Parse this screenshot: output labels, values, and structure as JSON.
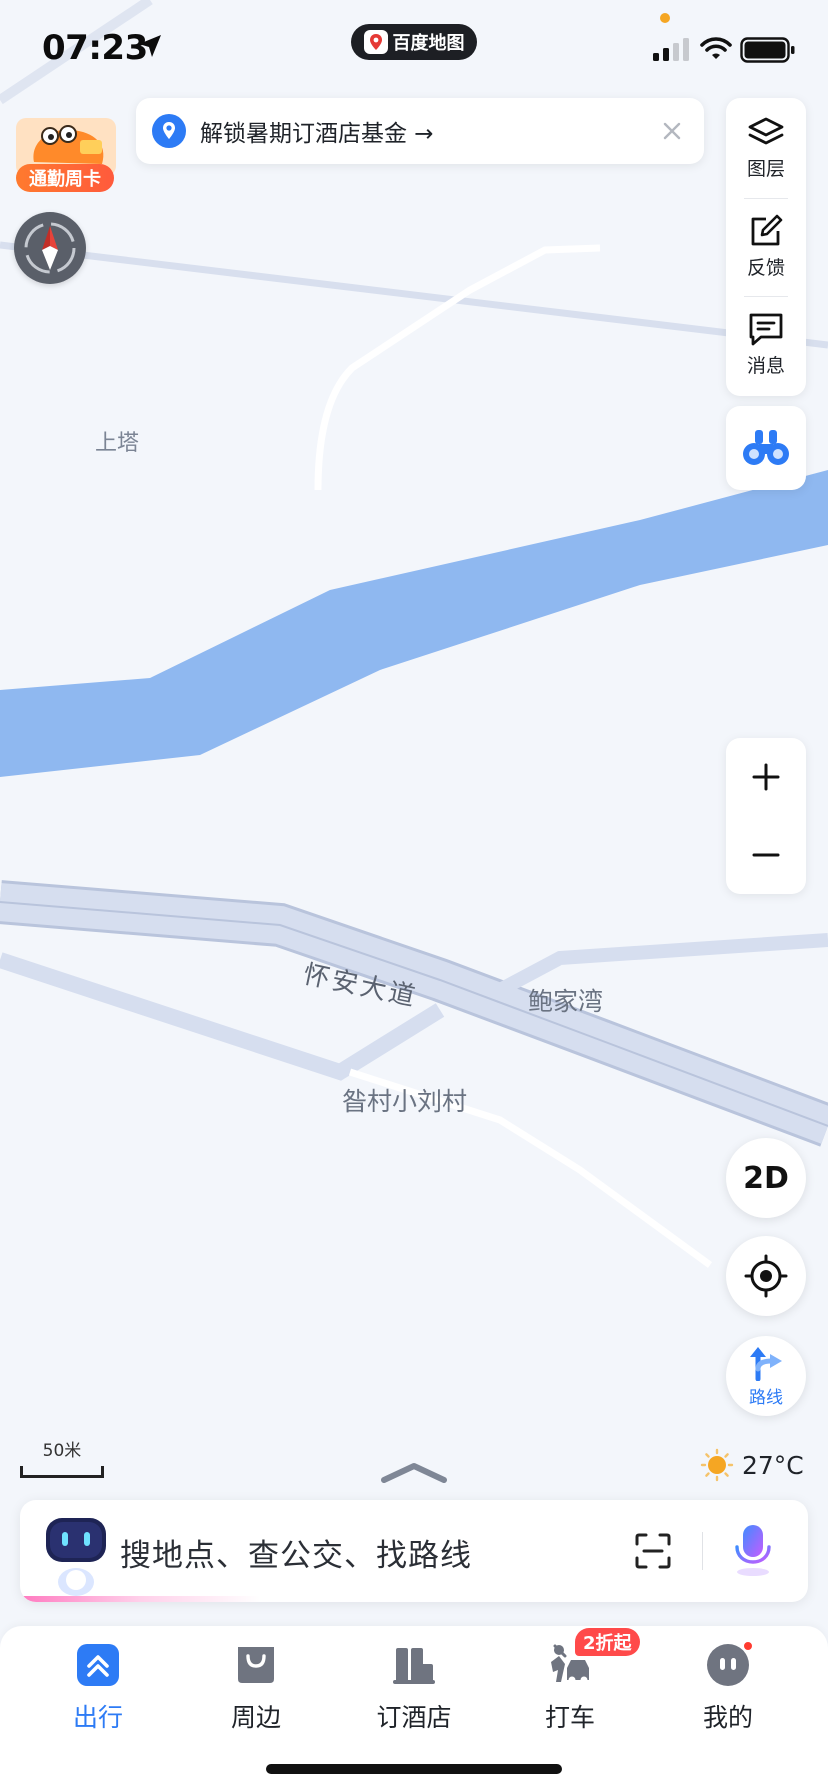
{
  "status_bar": {
    "time": "07:23",
    "app_pill_label": "百度地图"
  },
  "promo": {
    "badge_label": "通勤周卡"
  },
  "notice": {
    "text": "解锁暑期订酒店基金 →"
  },
  "toolbar": {
    "items": [
      {
        "label": "图层",
        "icon": "layers-icon"
      },
      {
        "label": "反馈",
        "icon": "feedback-icon"
      },
      {
        "label": "消息",
        "icon": "message-icon"
      }
    ]
  },
  "map": {
    "labels": {
      "shangta": "上塔",
      "road": "怀安大道",
      "baojiawan": "鲍家湾",
      "village": "昝村小刘村"
    },
    "colors": {
      "land": "#f3f6fb",
      "water": "#8fb8f0",
      "road": "#d6deef",
      "road_edge": "#b9c4dc"
    }
  },
  "controls": {
    "view_mode": "2D",
    "route_label": "路线",
    "scale_label": "50米"
  },
  "weather": {
    "temperature": "27°C"
  },
  "search": {
    "placeholder": "搜地点、查公交、找路线"
  },
  "bottom_nav": {
    "items": [
      {
        "label": "出行",
        "active": true
      },
      {
        "label": "周边",
        "active": false
      },
      {
        "label": "订酒店",
        "active": false
      },
      {
        "label": "打车",
        "active": false
      },
      {
        "label": "我的",
        "active": false
      }
    ],
    "taxi_badge": "2折起"
  },
  "colors": {
    "accent": "#2d7bf5",
    "badge_red": "#ff4a4a"
  }
}
